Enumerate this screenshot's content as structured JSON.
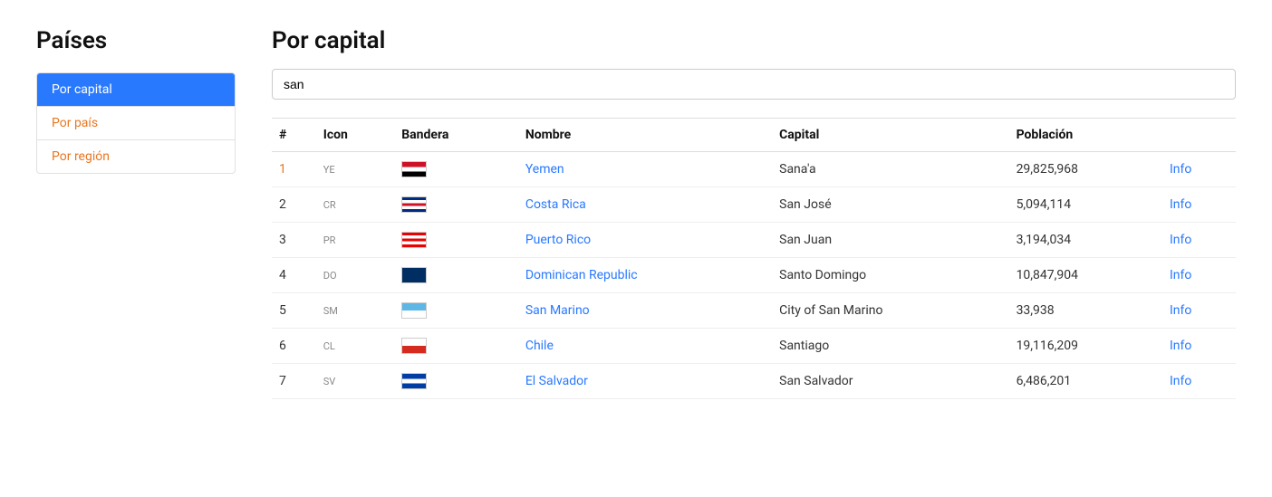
{
  "sidebar": {
    "title": "Países",
    "items": [
      {
        "id": "por-capital",
        "label": "Por capital",
        "active": true
      },
      {
        "id": "por-pais",
        "label": "Por país",
        "active": false
      },
      {
        "id": "por-region",
        "label": "Por región",
        "active": false
      }
    ]
  },
  "main": {
    "title": "Por capital",
    "search": {
      "value": "san",
      "placeholder": ""
    },
    "table": {
      "columns": [
        "#",
        "Icon",
        "Bandera",
        "Nombre",
        "Capital",
        "Población",
        ""
      ],
      "rows": [
        {
          "num": "1",
          "code": "YE",
          "flag": "ye",
          "name": "Yemen",
          "capital": "Sana'a",
          "population": "29,825,968"
        },
        {
          "num": "2",
          "code": "CR",
          "flag": "cr",
          "name": "Costa Rica",
          "capital": "San José",
          "population": "5,094,114"
        },
        {
          "num": "3",
          "code": "PR",
          "flag": "pr",
          "name": "Puerto Rico",
          "capital": "San Juan",
          "population": "3,194,034"
        },
        {
          "num": "4",
          "code": "DO",
          "flag": "do",
          "name": "Dominican Republic",
          "capital": "Santo Domingo",
          "population": "10,847,904"
        },
        {
          "num": "5",
          "code": "SM",
          "flag": "sm",
          "name": "San Marino",
          "capital": "City of San Marino",
          "population": "33,938"
        },
        {
          "num": "6",
          "code": "CL",
          "flag": "cl",
          "name": "Chile",
          "capital": "Santiago",
          "population": "19,116,209"
        },
        {
          "num": "7",
          "code": "SV",
          "flag": "sv",
          "name": "El Salvador",
          "capital": "San Salvador",
          "population": "6,486,201"
        }
      ],
      "info_label": "Info"
    }
  },
  "colors": {
    "accent": "#2979ff",
    "sidebar_active_bg": "#2979ff",
    "orange": "#e87722"
  }
}
